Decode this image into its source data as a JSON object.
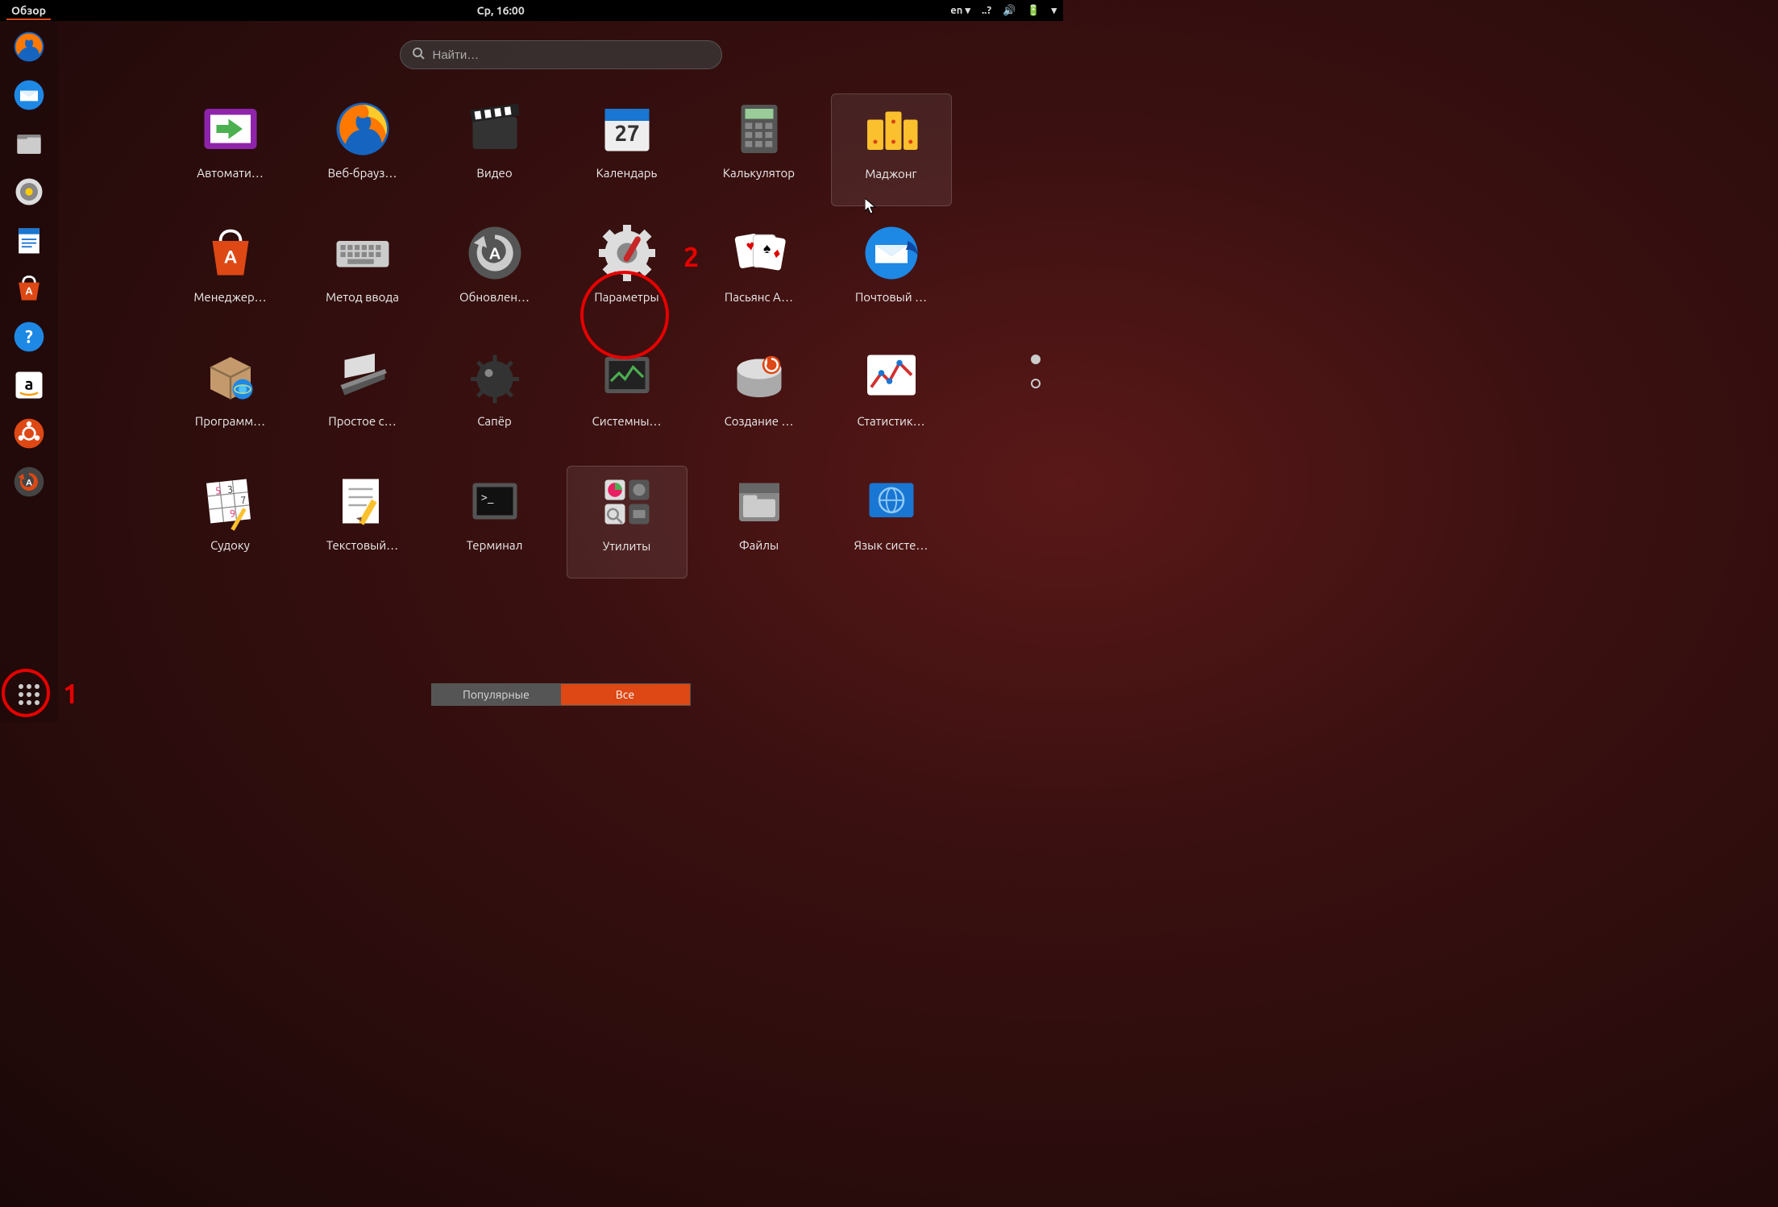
{
  "topbar": {
    "activities": "Обзор",
    "clock": "Ср, 16:00",
    "lang": "en"
  },
  "search": {
    "placeholder": "Найти…"
  },
  "dock": [
    {
      "name": "firefox-icon"
    },
    {
      "name": "thunderbird-icon"
    },
    {
      "name": "files-icon"
    },
    {
      "name": "rhythmbox-icon"
    },
    {
      "name": "writer-icon"
    },
    {
      "name": "software-icon"
    },
    {
      "name": "help-icon"
    },
    {
      "name": "amazon-icon"
    },
    {
      "name": "ubuntu-icon"
    },
    {
      "name": "updater-icon"
    }
  ],
  "apps": [
    {
      "label": "Автомати…",
      "icon": "autologin"
    },
    {
      "label": "Веб-брауз…",
      "icon": "firefox"
    },
    {
      "label": "Видео",
      "icon": "video"
    },
    {
      "label": "Календарь",
      "icon": "calendar"
    },
    {
      "label": "Калькулятор",
      "icon": "calculator"
    },
    {
      "label": "Маджонг",
      "icon": "mahjong"
    },
    {
      "label": "Менеджер…",
      "icon": "software"
    },
    {
      "label": "Метод ввода",
      "icon": "keyboard"
    },
    {
      "label": "Обновлен…",
      "icon": "updater"
    },
    {
      "label": "Параметры",
      "icon": "settings"
    },
    {
      "label": "Пасьянс А…",
      "icon": "solitaire"
    },
    {
      "label": "Почтовый …",
      "icon": "thunderbird"
    },
    {
      "label": "Программ…",
      "icon": "package"
    },
    {
      "label": "Простое с…",
      "icon": "scanner"
    },
    {
      "label": "Сапёр",
      "icon": "mines"
    },
    {
      "label": "Системны…",
      "icon": "monitor"
    },
    {
      "label": "Создание …",
      "icon": "disk"
    },
    {
      "label": "Статистик…",
      "icon": "stats"
    },
    {
      "label": "Судоку",
      "icon": "sudoku"
    },
    {
      "label": "Текстовый…",
      "icon": "text"
    },
    {
      "label": "Терминал",
      "icon": "terminal"
    },
    {
      "label": "Утилиты",
      "icon": "utilities"
    },
    {
      "label": "Файлы",
      "icon": "files"
    },
    {
      "label": "Язык систе…",
      "icon": "language"
    }
  ],
  "tabs": {
    "popular": "Популярные",
    "all": "Все",
    "active": "all"
  },
  "annotations": {
    "one": "1",
    "two": "2"
  },
  "calendar_day": "27"
}
